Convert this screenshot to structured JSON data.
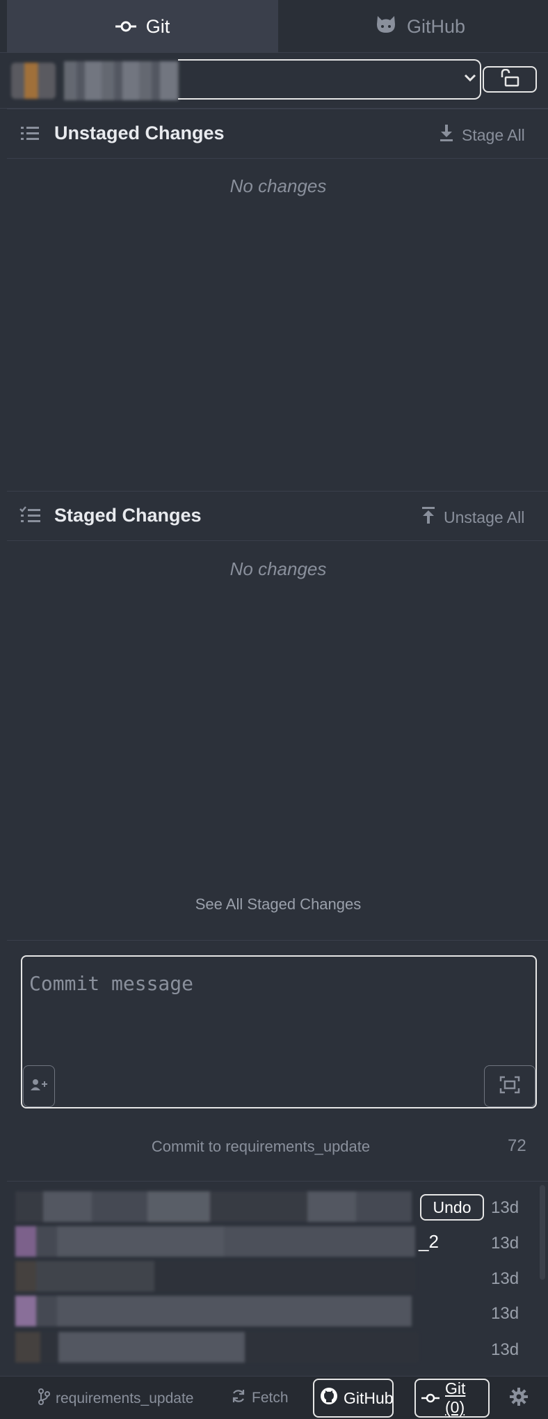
{
  "tabs": [
    {
      "label": "Git",
      "icon": "git-commit-icon",
      "active": true
    },
    {
      "label": "GitHub",
      "icon": "octocat-icon",
      "active": false
    }
  ],
  "unstaged": {
    "title": "Unstaged Changes",
    "action_label": "Stage All",
    "empty_label": "No changes"
  },
  "staged": {
    "title": "Staged Changes",
    "action_label": "Unstage All",
    "empty_label": "No changes",
    "see_all_label": "See All Staged Changes"
  },
  "commit": {
    "placeholder": "Commit message",
    "button_label": "Commit to requirements_update",
    "remaining_chars": "72"
  },
  "recent_commits": [
    {
      "time": "13d",
      "undo_label": "Undo"
    },
    {
      "time": "13d",
      "visible_suffix": "_2"
    },
    {
      "time": "13d"
    },
    {
      "time": "13d"
    },
    {
      "time": "13d"
    }
  ],
  "status_bar": {
    "branch": "requirements_update",
    "fetch_label": "Fetch",
    "github_label": "GitHub",
    "git_label": "Git (0)"
  },
  "colors": {
    "background": "#2c313a",
    "panel_border": "#3a3f4b",
    "muted_text": "#8a909c",
    "active_tab": "#3a3f4b"
  }
}
